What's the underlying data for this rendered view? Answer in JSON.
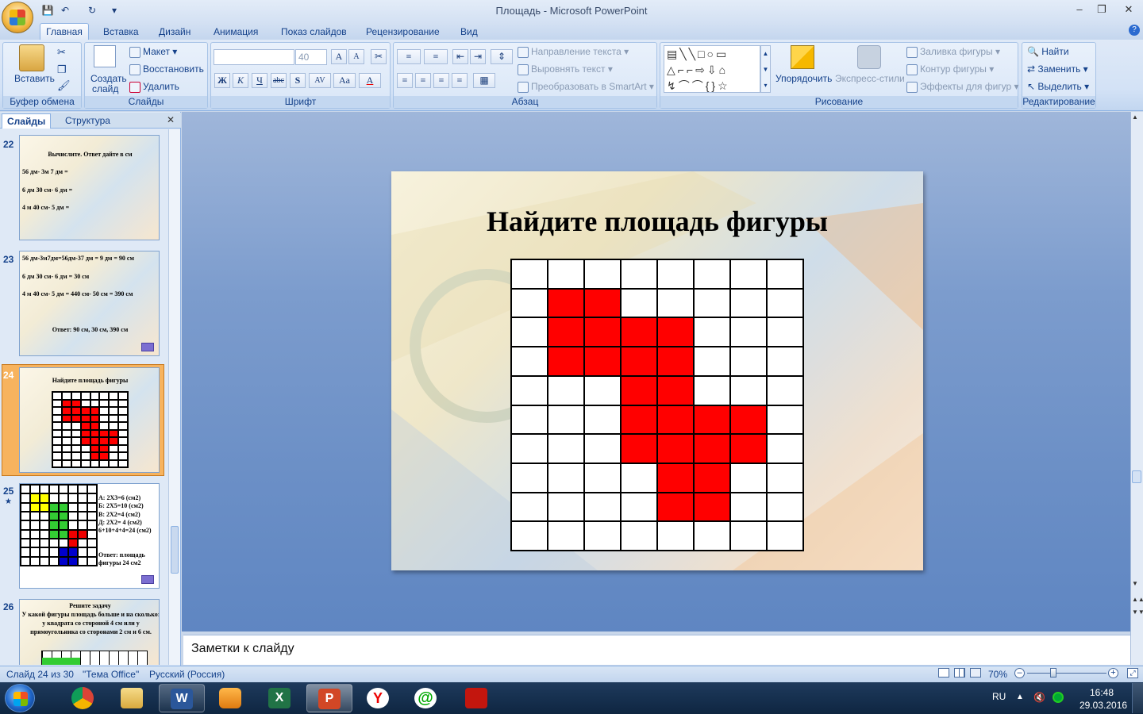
{
  "window": {
    "title": "Площадь - Microsoft PowerPoint"
  },
  "tabs": [
    "Главная",
    "Вставка",
    "Дизайн",
    "Анимация",
    "Показ слайдов",
    "Рецензирование",
    "Вид"
  ],
  "ribbon": {
    "clipboard": {
      "label": "Буфер обмена",
      "paste": "Вставить"
    },
    "slides": {
      "label": "Слайды",
      "create": "Создать",
      "create2": "слайд",
      "layout": "Макет",
      "reset": "Восстановить",
      "delete": "Удалить"
    },
    "font": {
      "label": "Шрифт",
      "size": "40"
    },
    "paragraph": {
      "label": "Абзац",
      "text_direction": "Направление текста",
      "align_text": "Выровнять текст",
      "smartart": "Преобразовать в SmartArt"
    },
    "drawing": {
      "label": "Рисование",
      "arrange": "Упорядочить",
      "quick_styles": "Экспресс-стили",
      "fill": "Заливка фигуры",
      "outline": "Контур фигуры",
      "effects": "Эффекты для фигур"
    },
    "editing": {
      "label": "Редактирование",
      "find": "Найти",
      "replace": "Заменить",
      "select": "Выделить"
    }
  },
  "left_panel": {
    "tab_slides": "Слайды",
    "tab_outline": "Структура",
    "slide22": {
      "num": "22",
      "title": "Вычислите. Ответ дайте в см",
      "l1": "56 дм- 3м 7 дм =",
      "l2": "6 дм 30 см- 6 дм =",
      "l3": "4 м 40 см- 5 дм ="
    },
    "slide23": {
      "num": "23",
      "l1": "56 дм-3м7дм=56дм-37 дм = 9 дм = 90 см",
      "l2": "6 дм 30 см- 6 дм = 30 см",
      "l3": "4 м 40 см- 5 дм = 440 см- 50 см = 390 см",
      "answer": "Ответ: 90 см, 30 см, 390 см"
    },
    "slide24": {
      "num": "24",
      "title": "Найдите площадь фигуры"
    },
    "slide25": {
      "num": "25",
      "a": "А: 2Х3=6 (см2)",
      "b": "Б: 2Х5=10 (см2)",
      "v": "В: 2Х2=4 (см2)",
      "d": "Д: 2Х2= 4 (см2)",
      "sum": "6+10+4+4=24 (см2)",
      "ans1": "Ответ: площадь",
      "ans2": "фигуры 24 см2"
    },
    "slide26": {
      "num": "26",
      "title": "Решите задачу",
      "text": "У какой фигуры площадь больше и на сколько: у квадрата со стороной 4 см или у прямоугольника со сторонами 2 см и 6 см."
    }
  },
  "slide": {
    "title": "Найдите площадь фигуры",
    "grid": [
      [
        0,
        0,
        0,
        0,
        0,
        0,
        0,
        0
      ],
      [
        0,
        1,
        1,
        0,
        0,
        0,
        0,
        0
      ],
      [
        0,
        1,
        1,
        1,
        1,
        0,
        0,
        0
      ],
      [
        0,
        1,
        1,
        1,
        1,
        0,
        0,
        0
      ],
      [
        0,
        0,
        0,
        1,
        1,
        0,
        0,
        0
      ],
      [
        0,
        0,
        0,
        1,
        1,
        1,
        1,
        0
      ],
      [
        0,
        0,
        0,
        1,
        1,
        1,
        1,
        0
      ],
      [
        0,
        0,
        0,
        0,
        1,
        1,
        0,
        0
      ],
      [
        0,
        0,
        0,
        0,
        1,
        1,
        0,
        0
      ],
      [
        0,
        0,
        0,
        0,
        0,
        0,
        0,
        0
      ]
    ],
    "fill_color": "#ff0000"
  },
  "notes": {
    "placeholder": "Заметки к слайду"
  },
  "status": {
    "slide": "Слайд 24 из 30",
    "theme": "\"Тема Office\"",
    "lang": "Русский (Россия)",
    "zoom": "70%"
  },
  "taskbar": {
    "lang": "RU",
    "time": "16:48",
    "date": "29.03.2016"
  }
}
